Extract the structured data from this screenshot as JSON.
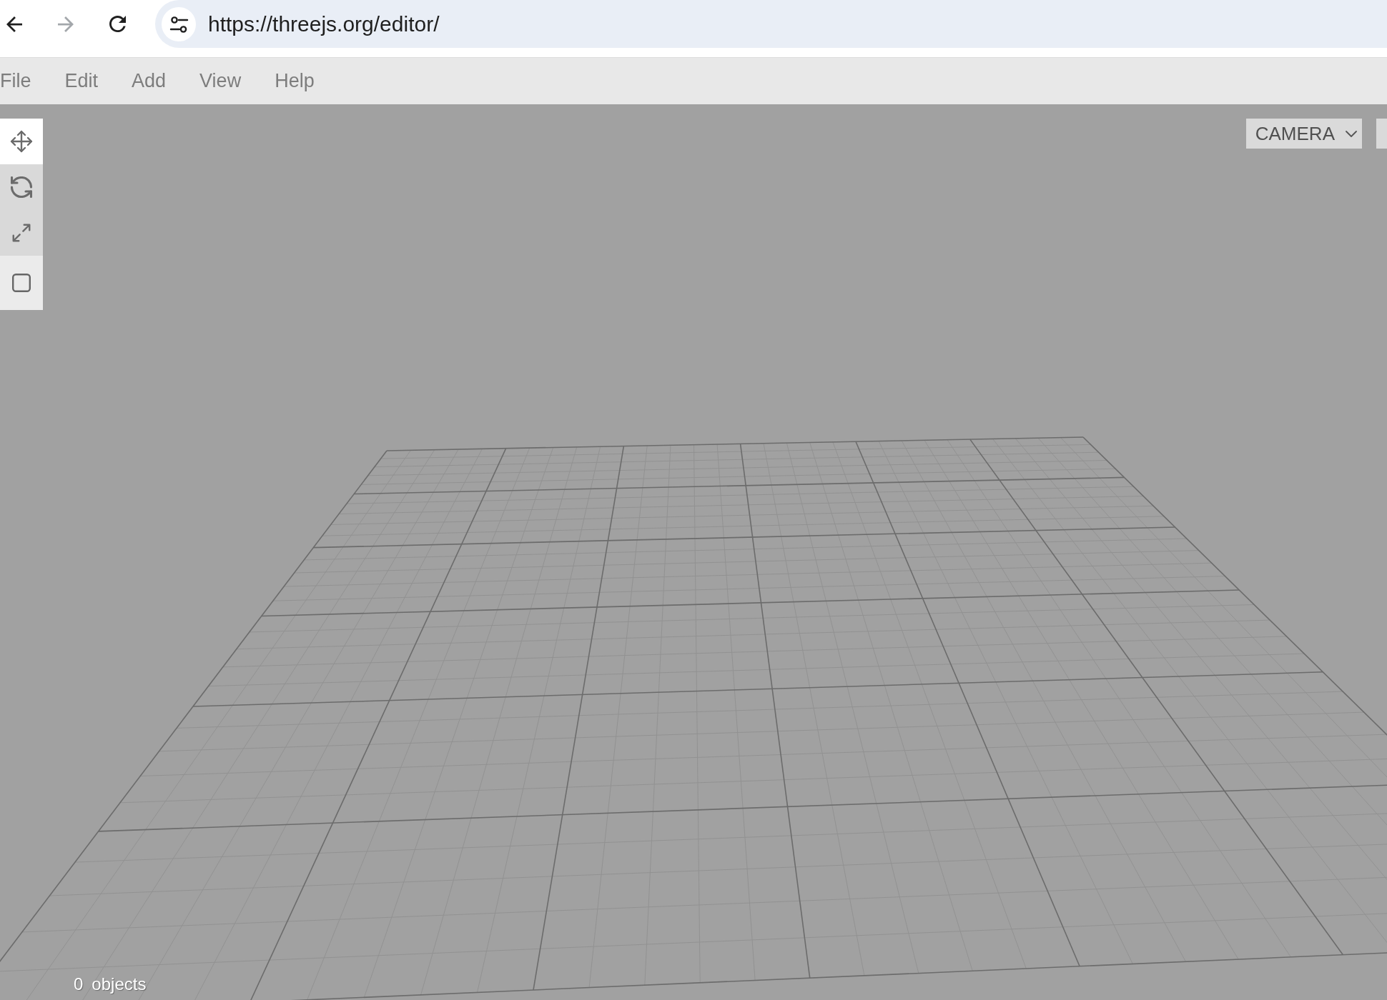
{
  "browser": {
    "back": {
      "disabled": false
    },
    "forward": {
      "disabled": true
    },
    "url": "https://threejs.org/editor/"
  },
  "menubar": {
    "items": [
      "File",
      "Edit",
      "Add",
      "View",
      "Help"
    ]
  },
  "toolbar": {
    "tools": [
      {
        "kind": "translate",
        "selected": true
      },
      {
        "kind": "rotate",
        "selected": false
      },
      {
        "kind": "scale",
        "selected": false
      }
    ],
    "local": {
      "checked": false
    }
  },
  "viewport": {
    "dropdowns": [
      {
        "kind": "select",
        "value": "CAMERA"
      },
      {
        "kind": "cut_off"
      }
    ]
  },
  "info": [
    {
      "count": "0",
      "label": "objects"
    }
  ]
}
